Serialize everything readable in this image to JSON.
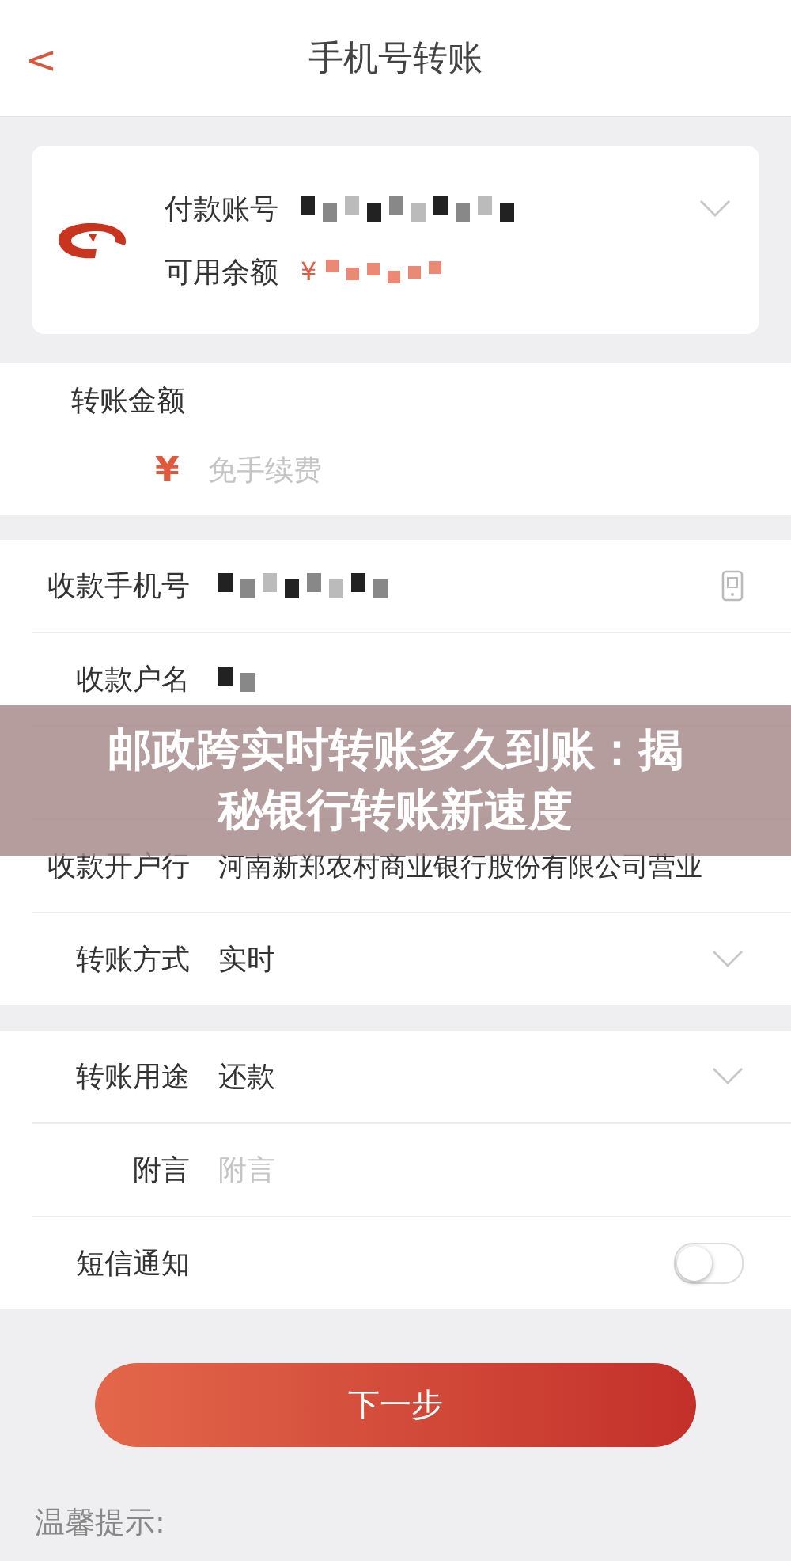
{
  "header": {
    "back": "<",
    "title": "手机号转账"
  },
  "payer": {
    "account_label": "付款账号",
    "balance_label": "可用余额",
    "currency": "¥"
  },
  "amount": {
    "label": "转账金额",
    "currency": "¥",
    "placeholder": "免手续费"
  },
  "payee_rows": [
    {
      "kind": "masked_phone",
      "label": "收款手机号"
    },
    {
      "kind": "masked",
      "label": "收款户名"
    },
    {
      "kind": "hidden"
    },
    {
      "kind": "text",
      "label": "收款开户行",
      "value": "河南新郑农村商业银行股份有限公司营业"
    },
    {
      "kind": "select",
      "label": "转账方式",
      "value": "实时"
    }
  ],
  "extra_rows": [
    {
      "kind": "select",
      "label": "转账用途",
      "value": "还款"
    },
    {
      "kind": "input",
      "label": "附言",
      "placeholder": "附言"
    },
    {
      "kind": "toggle",
      "label": "短信通知",
      "on": false
    }
  ],
  "next_button": "下一步",
  "tips_title": "温馨提示:",
  "banner": "邮政跨实时转账多久到账：揭秘银行转账新速度"
}
